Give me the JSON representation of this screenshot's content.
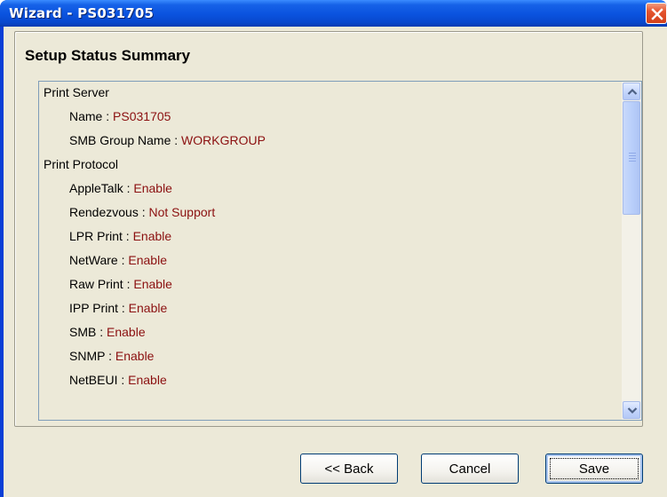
{
  "window": {
    "title": "Wizard - PS031705",
    "close_icon": "close-icon"
  },
  "summary": {
    "heading": "Setup Status Summary",
    "rows": [
      {
        "type": "section",
        "label": "Print Server"
      },
      {
        "type": "item",
        "label": "Name",
        "value": "PS031705"
      },
      {
        "type": "item",
        "label": "SMB Group Name",
        "value": "WORKGROUP"
      },
      {
        "type": "section",
        "label": "Print Protocol"
      },
      {
        "type": "item",
        "label": "AppleTalk",
        "value": "Enable"
      },
      {
        "type": "item",
        "label": "Rendezvous",
        "value": "Not Support"
      },
      {
        "type": "item",
        "label": "LPR Print",
        "value": "Enable"
      },
      {
        "type": "item",
        "label": "NetWare",
        "value": "Enable"
      },
      {
        "type": "item",
        "label": "Raw Print",
        "value": "Enable"
      },
      {
        "type": "item",
        "label": "IPP Print",
        "value": "Enable"
      },
      {
        "type": "item",
        "label": "SMB",
        "value": "Enable"
      },
      {
        "type": "item",
        "label": "SNMP",
        "value": "Enable"
      },
      {
        "type": "item",
        "label": "NetBEUI",
        "value": "Enable"
      }
    ],
    "separator": " : "
  },
  "buttons": {
    "back": "<< Back",
    "cancel": "Cancel",
    "save": "Save"
  },
  "colors": {
    "value_text": "#8b1010",
    "titlebar": "#0a52de",
    "dialog_face": "#ece9d8"
  }
}
